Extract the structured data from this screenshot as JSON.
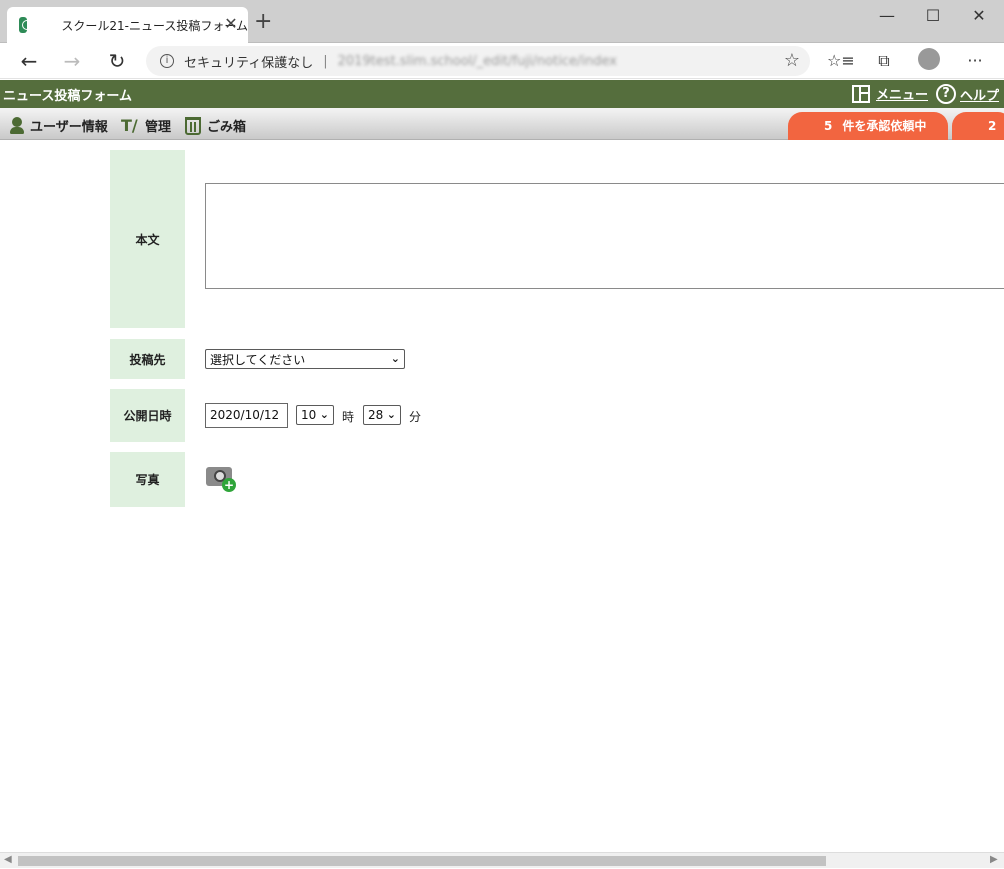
{
  "browser": {
    "tab_title": "スクール21-ニュース投稿フォーム",
    "tab_close": "✕",
    "new_tab": "+",
    "minimize": "—",
    "maximize": "☐",
    "close": "✕",
    "back": "←",
    "forward": "→",
    "reload": "↻",
    "info": "i",
    "security_text": "セキュリティ保護なし",
    "separator": "|",
    "url": "2019test.slim.school/_edit/fuji/notice/index",
    "star": "☆",
    "favorites": "☆≡",
    "collections": "⧉",
    "more": "···"
  },
  "header": {
    "app_title": "ニュース投稿フォーム",
    "menu_label": "メニュー",
    "help_label": "ヘルプ",
    "help_glyph": "?"
  },
  "subheader": {
    "user_info": "ユーザー情報",
    "admin": "管理",
    "trash": "ごみ箱",
    "approval_count": "5",
    "approval_label": "件を承認依頼中",
    "second_badge": "2",
    "tools_glyph": "T/"
  },
  "form": {
    "body_label": "本文",
    "body_value": "",
    "destination_label": "投稿先",
    "destination_value": "選択してください",
    "publish_label": "公開日時",
    "date_value": "2020/10/12",
    "hour_value": "10",
    "hour_unit": "時",
    "minute_value": "28",
    "minute_unit": "分",
    "photo_label": "写真",
    "chevron": "⌄",
    "plus": "+"
  },
  "scrollbar": {
    "left": "◀",
    "right": "▶"
  }
}
